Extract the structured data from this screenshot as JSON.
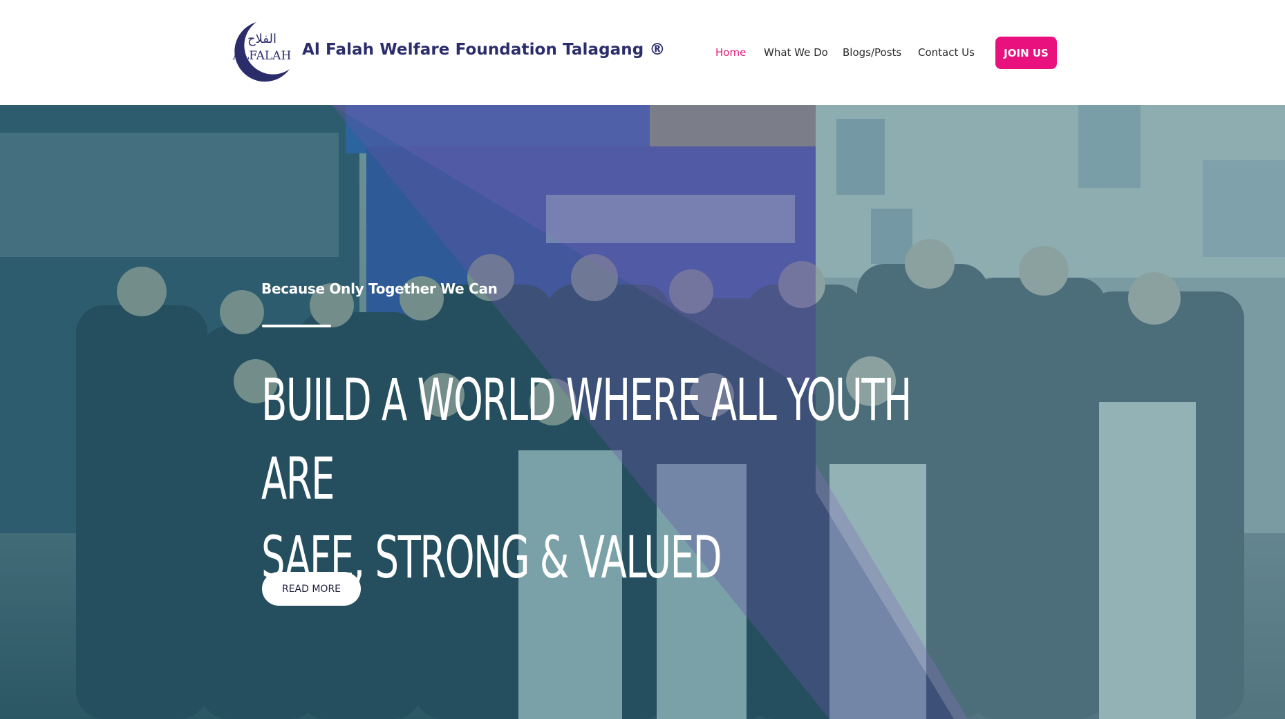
{
  "header": {
    "logo": {
      "icon": "alfalah-crescent-logo",
      "arabic_text": "الفلاح",
      "latin_text": "ALFALAH"
    },
    "brand_name": "Al Falah Welfare Foundation Talagang ®",
    "nav": [
      {
        "label": "Home",
        "active": true
      },
      {
        "label": "What We Do",
        "active": false
      },
      {
        "label": "Blogs/Posts",
        "active": false
      },
      {
        "label": "Contact Us",
        "active": false
      }
    ],
    "cta_label": "JOIN US"
  },
  "hero": {
    "tagline": "Because Only Together We Can",
    "heading_line1": "BUILD A WORLD WHERE ALL YOUTH ARE",
    "heading_line2": "SAFE, STRONG & VALUED",
    "button_label": "READ MORE",
    "background": "group-photo-of-foundation-members-at-seminar"
  },
  "colors": {
    "accent": "#e8117d",
    "brand_navy": "#2b2d6b",
    "overlay_teal": "#2e7a88",
    "overlay_purple": "#6a52a8"
  }
}
